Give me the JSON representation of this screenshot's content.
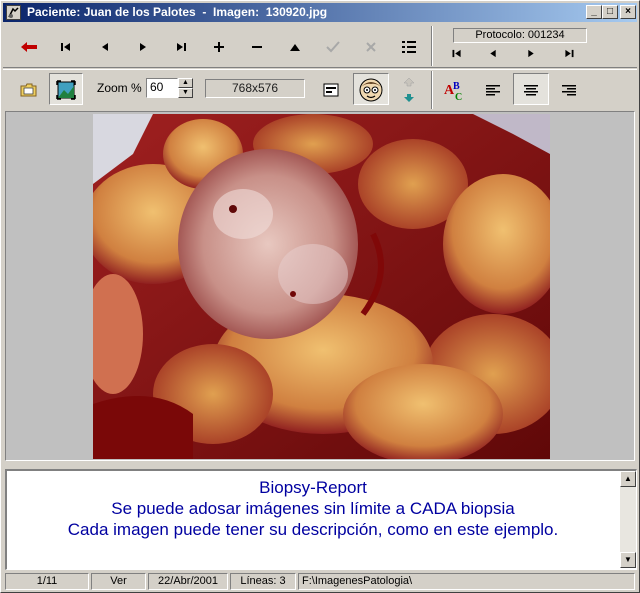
{
  "window": {
    "title": "Paciente: Juan de los Palotes  -  Imagen:  130920.jpg"
  },
  "toolbar_nav": {
    "tools": [
      {
        "name": "back-icon",
        "glyph": "←"
      },
      {
        "name": "first-icon",
        "glyph": "|◂"
      },
      {
        "name": "previous-icon",
        "glyph": "◂"
      },
      {
        "name": "next-icon",
        "glyph": "▸"
      },
      {
        "name": "last-icon",
        "glyph": "▸|"
      },
      {
        "name": "add-icon",
        "glyph": "+"
      },
      {
        "name": "remove-icon",
        "glyph": "−"
      },
      {
        "name": "up-icon",
        "glyph": "▲"
      },
      {
        "name": "confirm-icon",
        "glyph": "✔"
      },
      {
        "name": "cancel-icon",
        "glyph": "✖"
      },
      {
        "name": "list-icon",
        "glyph": "☰"
      }
    ]
  },
  "protocol": {
    "label": "Protocolo: 001234",
    "nav": [
      "|◂",
      "◂",
      "▸",
      "▸|"
    ]
  },
  "toolbar_view": {
    "zoom_label": "Zoom %",
    "zoom_value": "60",
    "dimensions": "768x576"
  },
  "description": {
    "lines": [
      "Biopsy-Report",
      "Se puede adosar imágenes sin límite a CADA biopsia",
      "Cada imagen puede tener su descripción, como en este ejemplo."
    ]
  },
  "status": {
    "index": "1/11",
    "mode": "Ver",
    "date": "22/Abr/2001",
    "lines": "Líneas: 3",
    "path": "F:\\ImagenesPatologia\\"
  },
  "colors": {
    "description_text": "#0000a0",
    "titlebar_start": "#0a246a",
    "titlebar_end": "#a6caf0"
  }
}
